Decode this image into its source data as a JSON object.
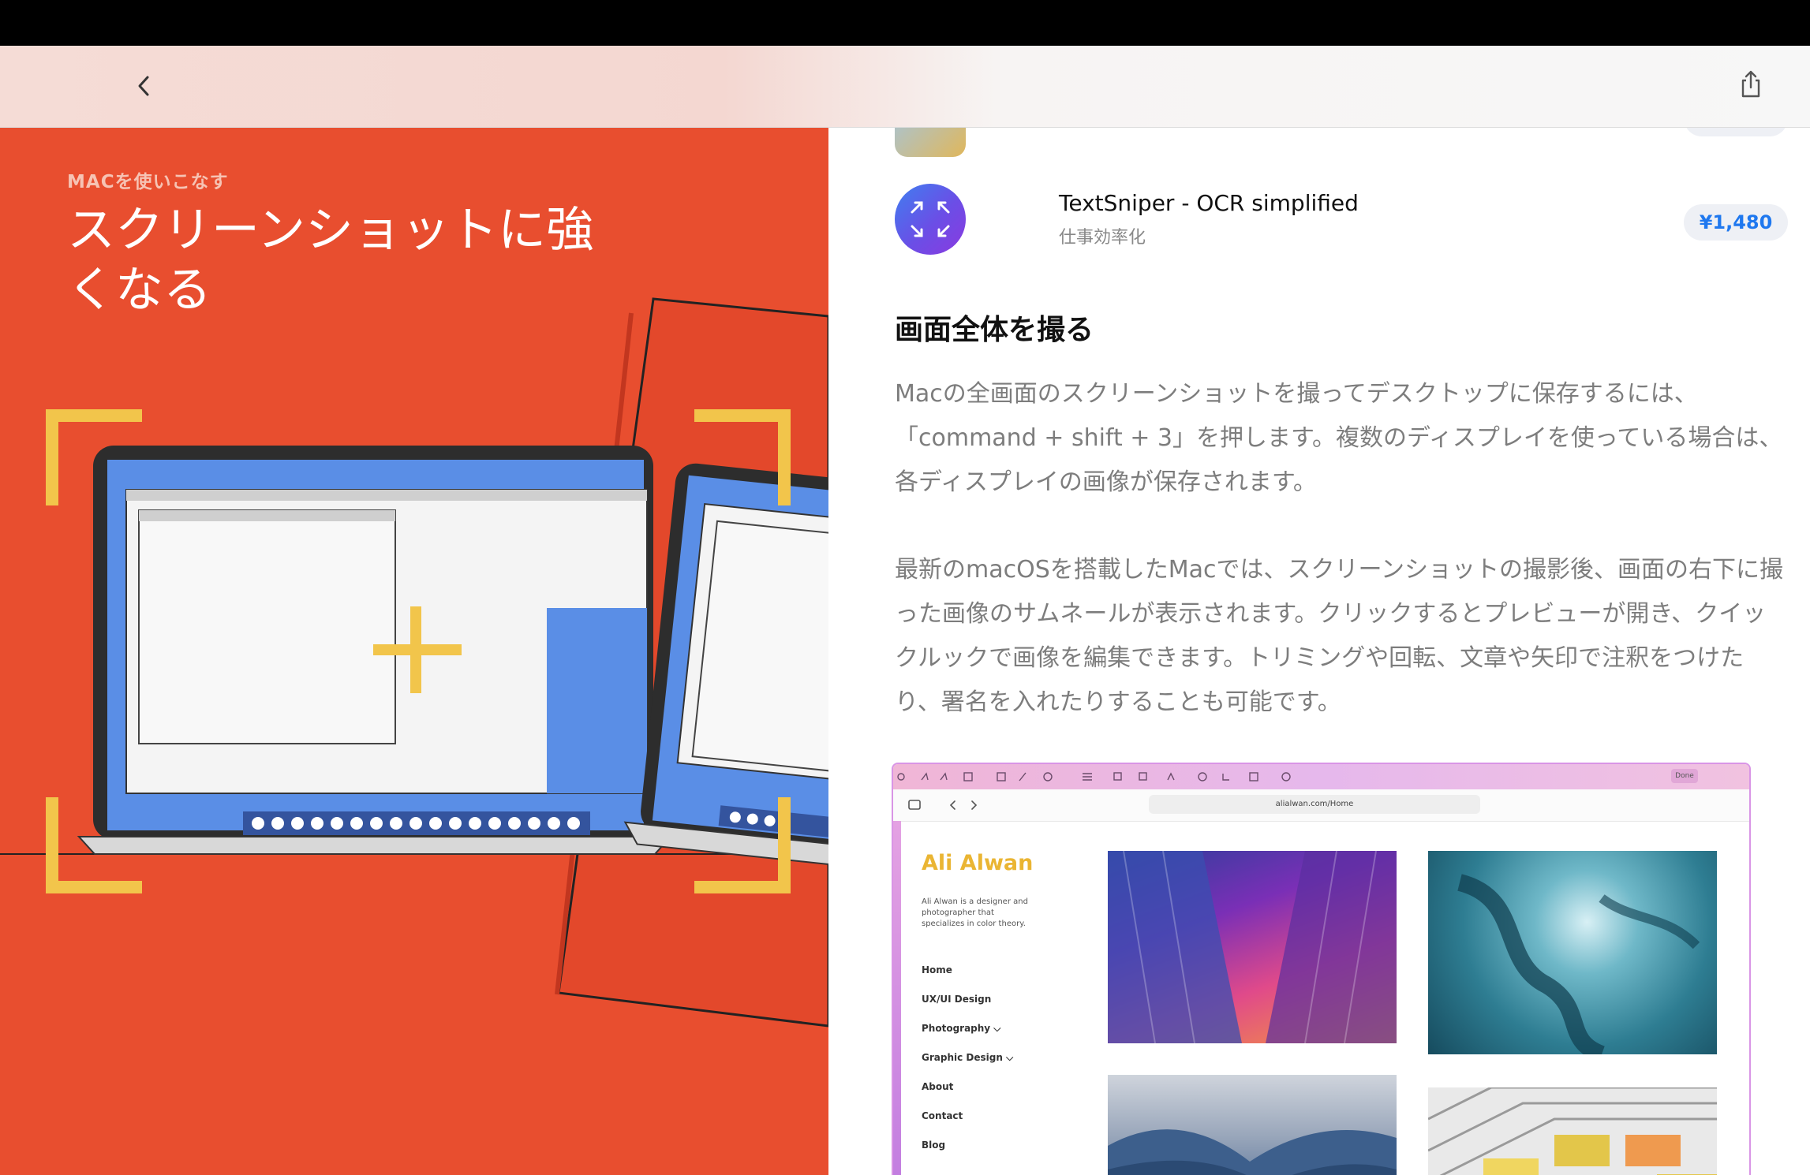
{
  "colors": {
    "hero_bg": "#e84e2f",
    "accent": "#1f78ef",
    "bracket": "#f2c54b",
    "laptop_screen": "#5a8ee6"
  },
  "nav": {
    "back_icon": "chevron-left-icon",
    "share_icon": "share-icon"
  },
  "hero": {
    "eyebrow": "MACを使いこなす",
    "title": "スクリーンショットに強くなる"
  },
  "apps": [
    {
      "name": "TextSniper - OCR simplified",
      "category": "仕事効率化",
      "price": "¥1,480",
      "icon": "textsniper-icon"
    }
  ],
  "article": {
    "heading": "画面全体を撮る",
    "paragraph1": "Macの全画面のスクリーンショットを撮ってデスクトップに保存するには、「command + shift + 3」を押します。複数のディスプレイを使っている場合は、各ディスプレイの画像が保存されます。",
    "paragraph2": "最新のmacOSを搭載したMacでは、スクリーンショットの撮影後、画面の右下に撮った画像のサムネールが表示されます。クリックするとプレビューが開き、クイックルックで画像を編集できます。トリミングや回転、文章や矢印で注釈をつけたり、署名を入れたりすることも可能です。"
  },
  "screenshot": {
    "done_label": "Done",
    "url": "alialwan.com/Home",
    "site_title": "Ali Alwan",
    "bio": "Ali Alwan is a designer and photographer that specializes in color theory.",
    "nav": [
      "Home",
      "UX/UI Design",
      "Photography ⌵",
      "Graphic Design ⌵",
      "About",
      "Contact",
      "Blog"
    ]
  }
}
